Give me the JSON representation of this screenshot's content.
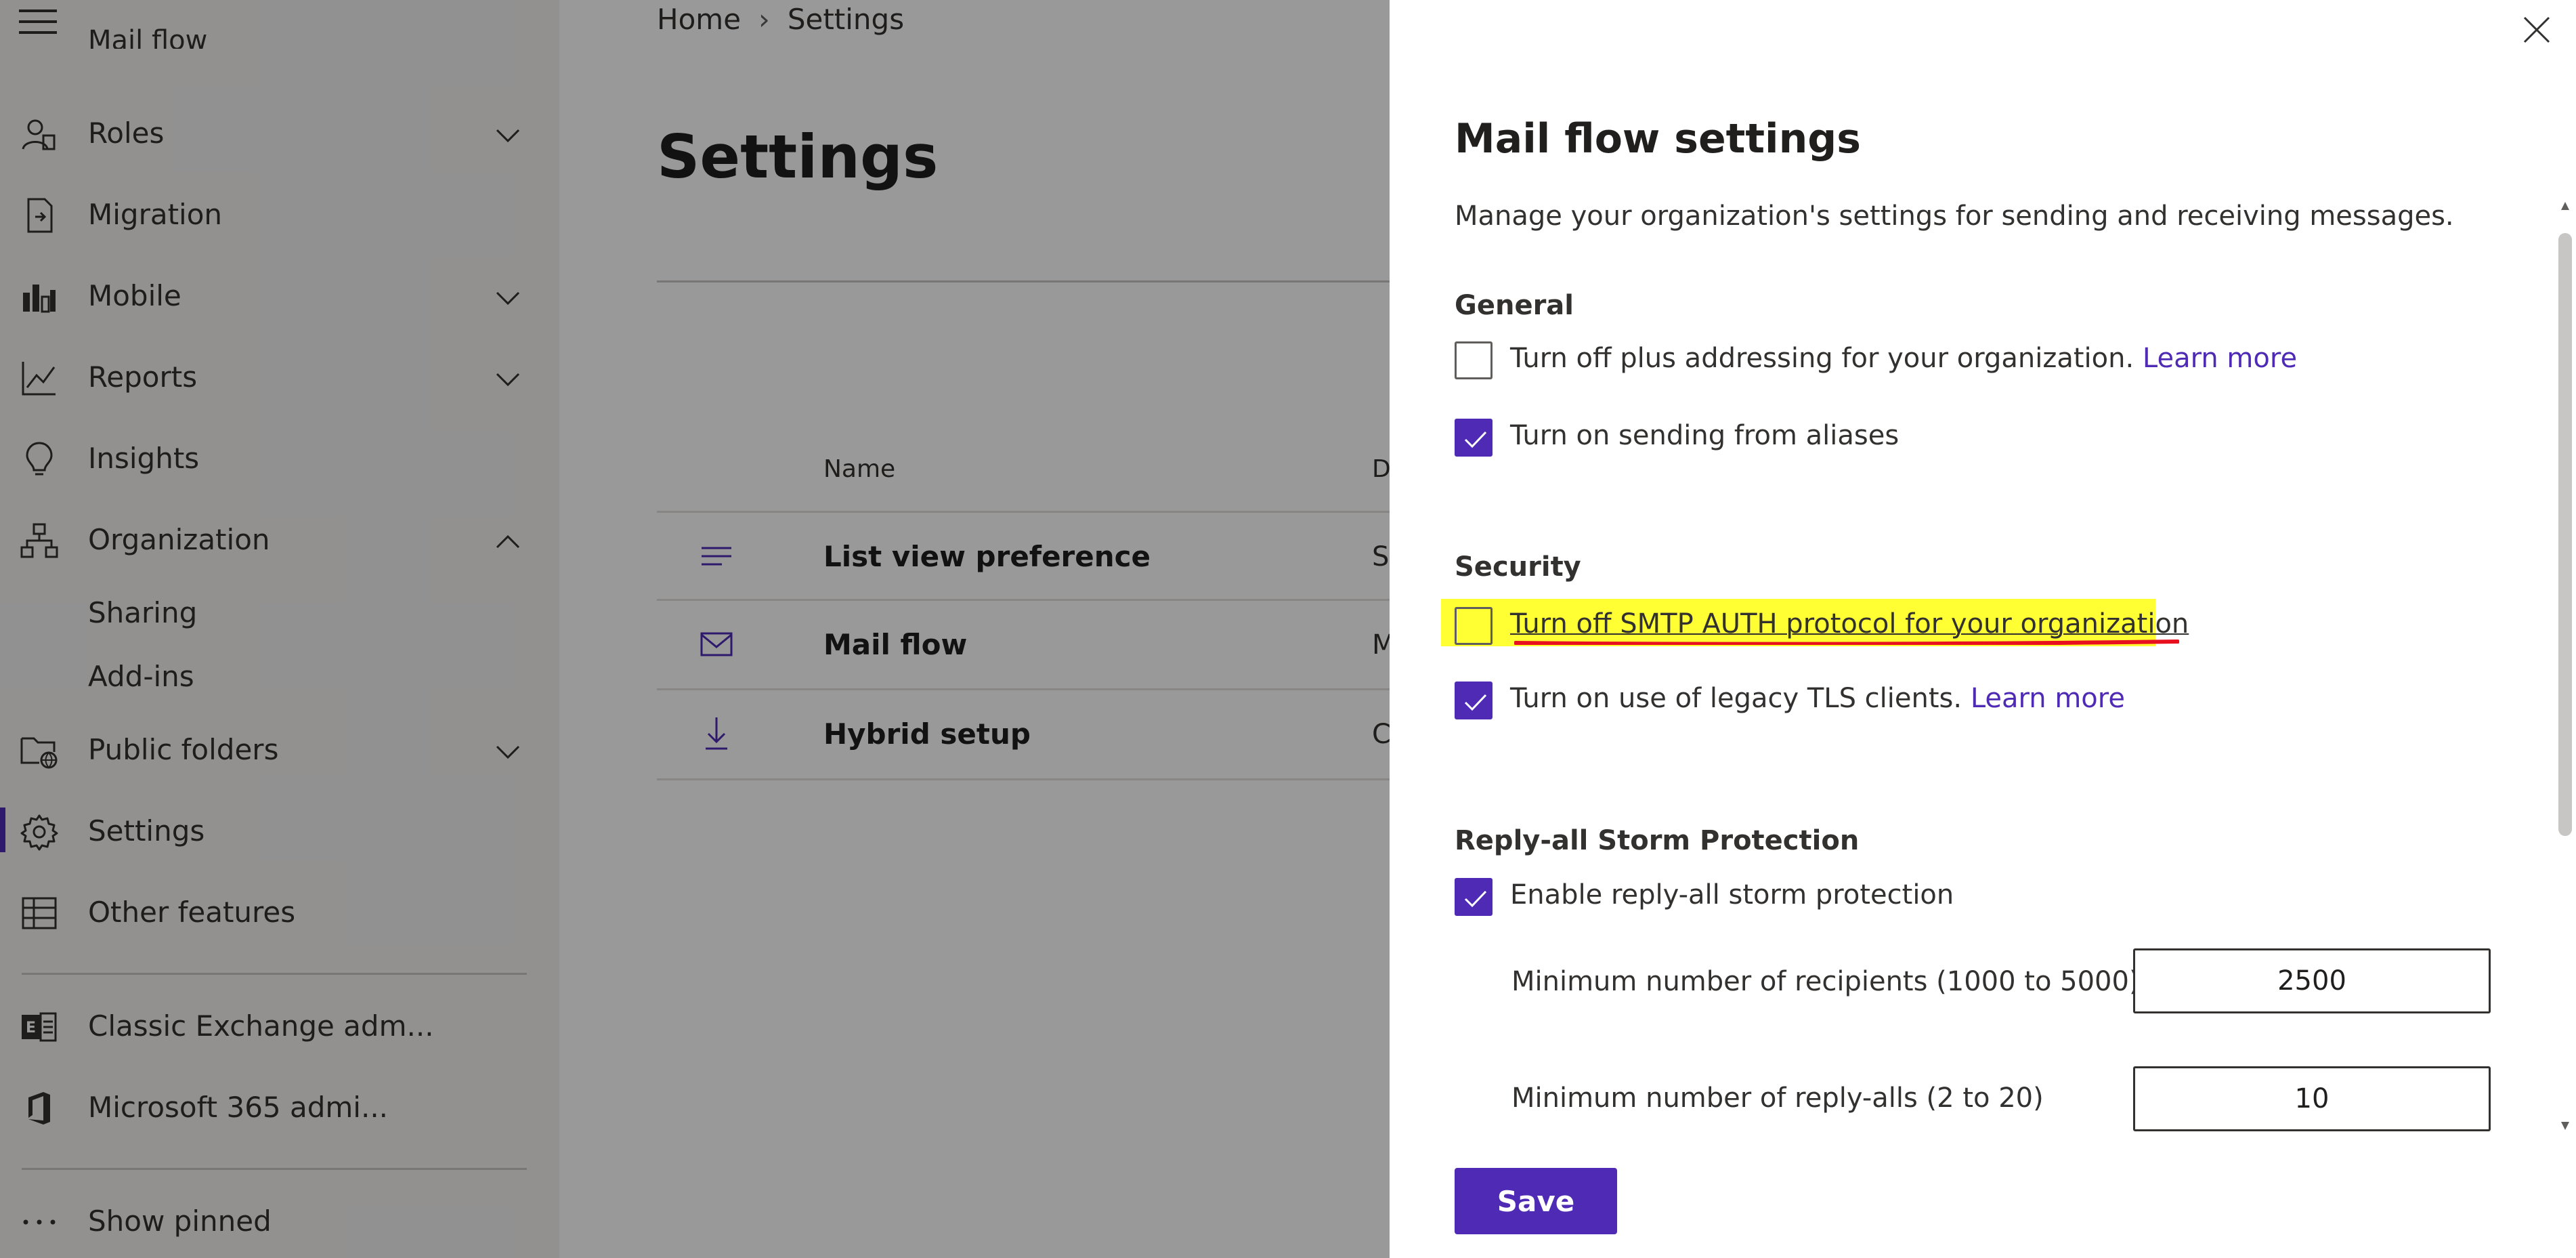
{
  "sidebar": {
    "cut_item": "Mail flow",
    "items": [
      {
        "label": "Roles",
        "icon": "roles-icon"
      },
      {
        "label": "Migration",
        "icon": "migration-icon"
      },
      {
        "label": "Mobile",
        "icon": "mobile-icon"
      },
      {
        "label": "Reports",
        "icon": "reports-icon"
      },
      {
        "label": "Insights",
        "icon": "lightbulb-icon"
      },
      {
        "label": "Organization",
        "icon": "organization-icon"
      },
      {
        "label": "Public folders",
        "icon": "public-folders-icon"
      },
      {
        "label": "Settings",
        "icon": "gear-icon"
      },
      {
        "label": "Other features",
        "icon": "grid-icon"
      },
      {
        "label": "Classic Exchange adm...",
        "icon": "exchange-icon"
      },
      {
        "label": "Microsoft 365 admi...",
        "icon": "office-icon"
      },
      {
        "label": "Show pinned",
        "icon": "more-icon"
      }
    ],
    "org_subitems": [
      "Sharing",
      "Add-ins"
    ],
    "active": "Settings"
  },
  "breadcrumb": {
    "home": "Home",
    "current": "Settings"
  },
  "page": {
    "title": "Settings",
    "columns": {
      "name": "Name",
      "description": "D"
    },
    "rows": [
      {
        "name": "List view preference",
        "desc": "S",
        "icon": "list-icon"
      },
      {
        "name": "Mail flow",
        "desc": "M",
        "icon": "mail-icon"
      },
      {
        "name": "Hybrid setup",
        "desc": "C",
        "icon": "download-icon"
      }
    ]
  },
  "panel": {
    "title": "Mail flow settings",
    "description": "Manage your organization's settings for sending and receiving messages.",
    "general": {
      "heading": "General",
      "plus_addressing": {
        "label": "Turn off plus addressing for your organization.",
        "link": "Learn more",
        "checked": false
      },
      "send_from_aliases": {
        "label": "Turn on sending from aliases",
        "checked": true
      }
    },
    "security": {
      "heading": "Security",
      "smtp_auth": {
        "label": "Turn off SMTP AUTH protocol for your organization",
        "checked": false,
        "highlight_color": "#ffff33",
        "underline_color": "#e8101e"
      },
      "legacy_tls": {
        "label": "Turn on use of legacy TLS clients.",
        "link": "Learn more",
        "checked": true
      }
    },
    "reply_all": {
      "heading": "Reply-all Storm Protection",
      "enable": {
        "label": "Enable reply-all storm protection",
        "checked": true
      },
      "min_recipients": {
        "label": "Minimum number of recipients (1000 to 5000)",
        "value": "2500"
      },
      "min_reply_alls": {
        "label": "Minimum number of reply-alls (2 to 20)",
        "value": "10"
      }
    },
    "save_label": "Save"
  },
  "colors": {
    "accent": "#4f2bb5",
    "overlay": "rgba(0,0,0,0.40)"
  }
}
